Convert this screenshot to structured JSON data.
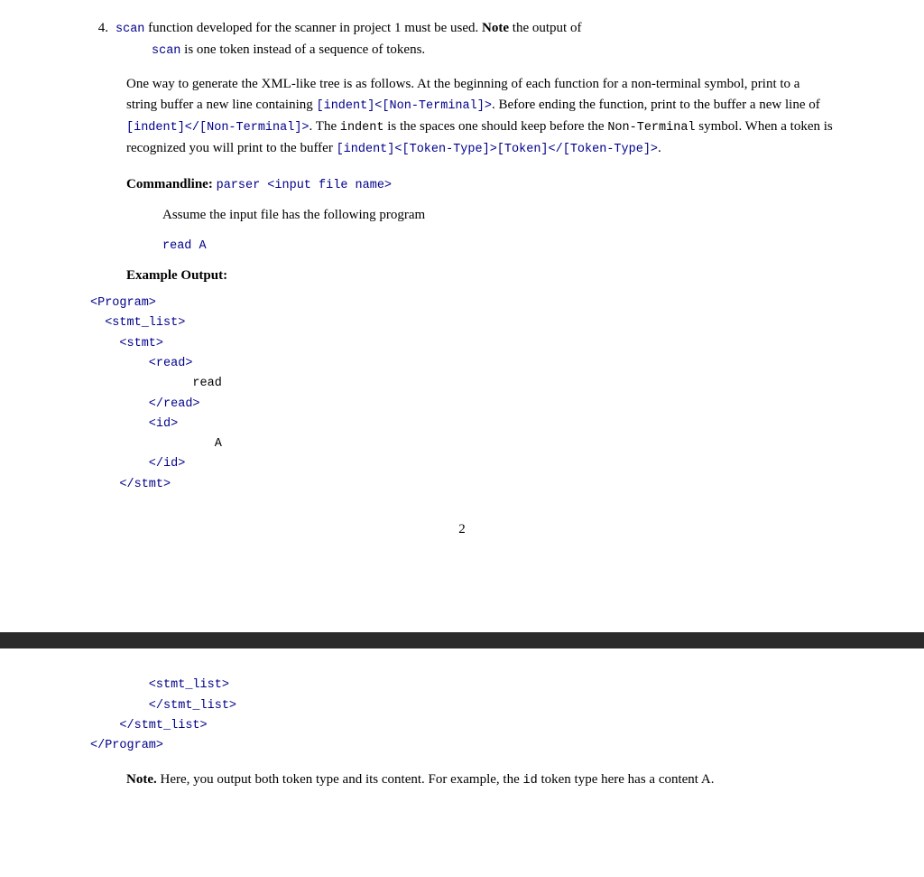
{
  "page": {
    "top": {
      "item4": {
        "number": "4.",
        "text_before_scan": "scan",
        "text_part1": " function developed for the scanner in project 1 must be used. ",
        "bold_note": "Note",
        "text_part2": " the output of",
        "line2_scan": "scan",
        "line2_rest": " is one token instead of a sequence of tokens."
      },
      "paragraph1": {
        "text": "One way to generate the XML-like tree is as follows. At the beginning of each function for a non-terminal symbol, print to a string buffer a new line containing ",
        "code1": "[indent]<[Non-Terminal]>",
        "text2": ". Before ending the function, print to the buffer a new line of ",
        "code2": "[indent]</[Non-Terminal]>",
        "text3": ". The ",
        "code3": "indent",
        "text4": " is the spaces one should keep before the ",
        "code4": "Non-Terminal",
        "text5": " symbol.  When a token is recognized you will print to the buffer ",
        "code5": "[indent]<[Token-Type]>[Token]</[Token-Type]>",
        "text6": "."
      },
      "commandline": {
        "label": "Commandline:",
        "code": "parser <input file name>",
        "line2": "Assume the input file has the following program",
        "line3_code": "read A",
        "example_label": "Example Output:"
      },
      "code_block_top": [
        {
          "line": "<Program>",
          "indent": 0
        },
        {
          "line": "<stmt_list>",
          "indent": 2
        },
        {
          "line": "<stmt>",
          "indent": 4
        },
        {
          "line": "<read>",
          "indent": 8
        },
        {
          "line": "read",
          "indent": 12,
          "black": true
        },
        {
          "line": "</read>",
          "indent": 8
        },
        {
          "line": "<id>",
          "indent": 8
        },
        {
          "line": "A",
          "indent": 14,
          "black": true
        },
        {
          "line": "</id>",
          "indent": 8
        },
        {
          "line": "</stmt>",
          "indent": 4
        }
      ],
      "page_number": "2"
    },
    "bottom": {
      "code_block": [
        {
          "line": "<stmt_list>",
          "indent": 8
        },
        {
          "line": "</stmt_list>",
          "indent": 8
        },
        {
          "line": "</stmt_list>",
          "indent": 4
        },
        {
          "line": "</Program>",
          "indent": 0
        }
      ],
      "note": {
        "bold_note": "Note.",
        "text1": " Here, you output both token type and its content. For example, the ",
        "code_id": "id",
        "text2": " token type here has a content A."
      }
    }
  }
}
